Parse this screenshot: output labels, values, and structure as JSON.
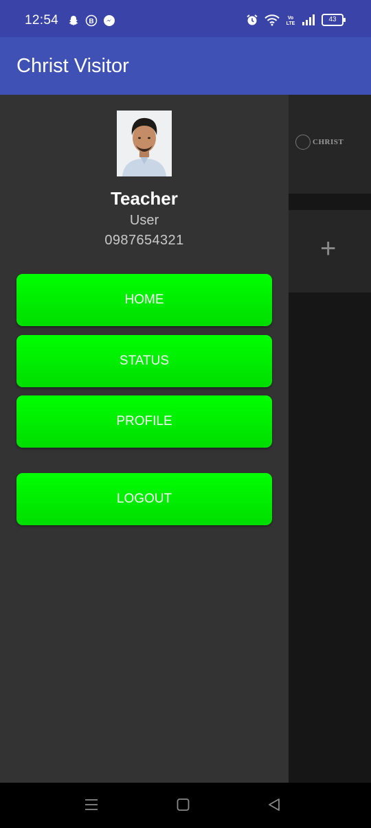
{
  "status_bar": {
    "time": "12:54",
    "battery": "43",
    "icons_left": [
      "snapchat-icon",
      "b-badge-icon",
      "messenger-icon"
    ],
    "icons_right": [
      "alarm-icon",
      "wifi-icon",
      "volte-icon",
      "signal-icon",
      "battery-icon"
    ]
  },
  "app_bar": {
    "title": "Christ Visitor"
  },
  "drawer": {
    "profile": {
      "name": "Teacher",
      "role": "User",
      "phone": "0987654321"
    },
    "menu": [
      {
        "label": "HOME"
      },
      {
        "label": "STATUS"
      },
      {
        "label": "PROFILE"
      },
      {
        "label": "LOGOUT"
      }
    ]
  },
  "background": {
    "logo_text": "CHRIST",
    "add_symbol": "+"
  },
  "colors": {
    "status_bar": "#3a44a8",
    "app_bar": "#3f51b5",
    "drawer": "#333333",
    "button": "#00ff00"
  }
}
